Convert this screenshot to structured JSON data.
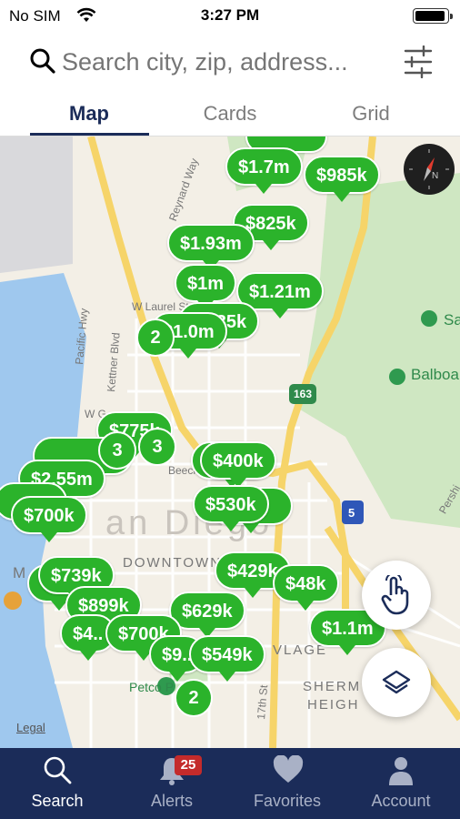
{
  "status_bar": {
    "carrier": "No SIM",
    "time": "3:27 PM",
    "battery_level": 0.85
  },
  "search": {
    "placeholder": "Search city, zip, address..."
  },
  "tabs": [
    {
      "label": "Map",
      "active": true
    },
    {
      "label": "Cards"
    },
    {
      "label": "Grid"
    }
  ],
  "map": {
    "city_label": "an Diego",
    "district_label": "DOWNTOWN",
    "places": [
      "W Laurel St",
      "Pacific Hwy",
      "Kettner Blvd",
      "Reynard Way",
      "W G",
      "Beech St",
      "Balboa",
      "Petco P",
      "Sa",
      "SHERM",
      "HEIGH",
      "VLAGE",
      "17th St",
      "Pershi",
      "M"
    ],
    "highway_labels": [
      "163",
      "5"
    ],
    "legal": "Legal",
    "price_pins": [
      "$1.7m",
      "$985k",
      "$825k",
      "$1.93m",
      "$1m",
      "$1.21m",
      "$1.35k",
      "$1.0m",
      "$775k",
      "$2.55m",
      "$400k",
      "$530k",
      "$700k",
      "$739k",
      "$429k",
      "$48k",
      "$899k",
      "$629k",
      "$4..",
      "$700k",
      "$1.1m",
      "$9..",
      "$549k"
    ],
    "clusters": [
      "2",
      "3",
      "3",
      "2"
    ]
  },
  "nav": [
    {
      "label": "Search",
      "icon": "search-icon",
      "active": true
    },
    {
      "label": "Alerts",
      "icon": "bell-icon",
      "badge": "25"
    },
    {
      "label": "Favorites",
      "icon": "heart-icon"
    },
    {
      "label": "Account",
      "icon": "person-icon"
    }
  ],
  "colors": {
    "pin_green": "#2bb32b",
    "nav_navy": "#1b2c59",
    "badge_red": "#c42b2b"
  }
}
